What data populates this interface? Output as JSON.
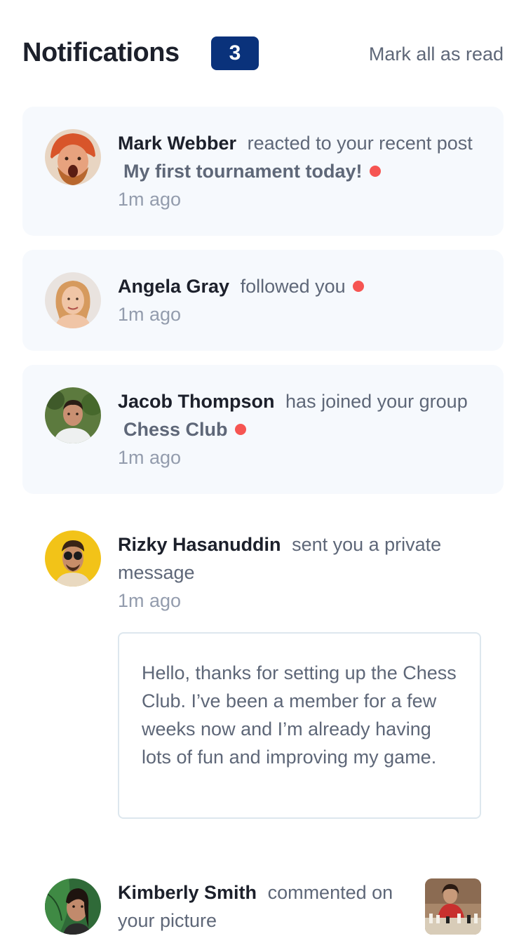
{
  "header": {
    "title": "Notifications",
    "unread_count": "3",
    "mark_all_label": "Mark all as read"
  },
  "notifications": [
    {
      "name": "Mark Webber",
      "action": "reacted to your recent post",
      "target": "My first tournament today!",
      "time": "1m ago",
      "unread": true,
      "avatar_icon": "avatar-mark-webber"
    },
    {
      "name": "Angela Gray",
      "action": "followed you",
      "time": "1m ago",
      "unread": true,
      "avatar_icon": "avatar-angela-gray"
    },
    {
      "name": "Jacob Thompson",
      "action": "has joined your group",
      "group": "Chess Club",
      "time": "1m ago",
      "unread": true,
      "avatar_icon": "avatar-jacob-thompson"
    },
    {
      "name": "Rizky Hasanuddin",
      "action": "sent you a private message",
      "time": "1m ago",
      "message": "Hello, thanks for setting up the Chess Club. I’ve been a member for a few weeks now and I’m already having lots of fun and improving my game.",
      "unread": false,
      "avatar_icon": "avatar-rizky-hasanuddin"
    },
    {
      "name": "Kimberly Smith",
      "action": "commented on your picture",
      "unread": false,
      "avatar_icon": "avatar-kimberly-smith",
      "thumbnail_icon": "chess-picture-thumbnail"
    }
  ],
  "colors": {
    "badge_bg": "#0a327b",
    "unread_bg": "#f6f9fd",
    "dot": "#f65552",
    "heading": "#1c202b",
    "body": "#5e6778",
    "muted": "#939cad"
  }
}
